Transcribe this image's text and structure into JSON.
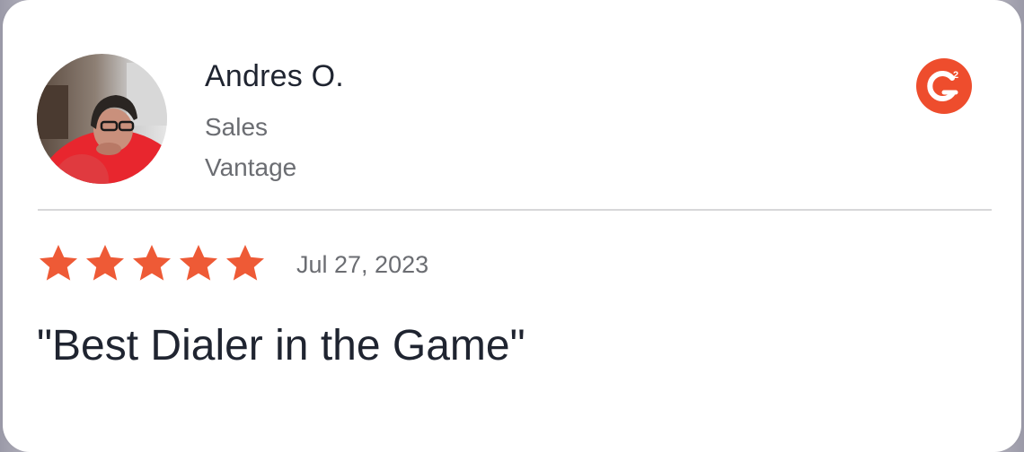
{
  "review": {
    "reviewer_name": "Andres O.",
    "reviewer_role": "Sales",
    "reviewer_company": "Vantage",
    "source_icon": "g2-logo-icon",
    "rating": 5,
    "rating_max": 5,
    "date": "Jul 27, 2023",
    "headline": "\"Best Dialer in the Game\""
  },
  "colors": {
    "star": "#ee5a36",
    "g2_brand": "#ee4d2d",
    "text_primary": "#1f2430",
    "text_secondary": "#6b6d72",
    "divider": "#d7d7d9"
  }
}
